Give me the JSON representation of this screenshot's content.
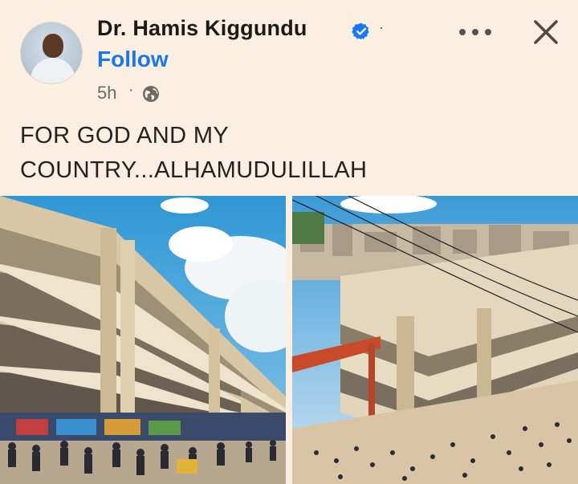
{
  "post": {
    "author_name": "Dr. Hamis Kiggundu",
    "follow_label": "Follow",
    "timestamp": "5h",
    "separator": "·",
    "name_separator": "·",
    "text": "FOR GOD AND MY COUNTRY...ALHAMUDULILLAH"
  },
  "colors": {
    "background": "#fbefe2",
    "follow_blue": "#1877f2",
    "verified_blue": "#1877f2"
  },
  "icons": {
    "verified": "verified-badge-icon",
    "privacy": "globe-icon",
    "more": "more-options-icon",
    "close": "close-icon"
  }
}
